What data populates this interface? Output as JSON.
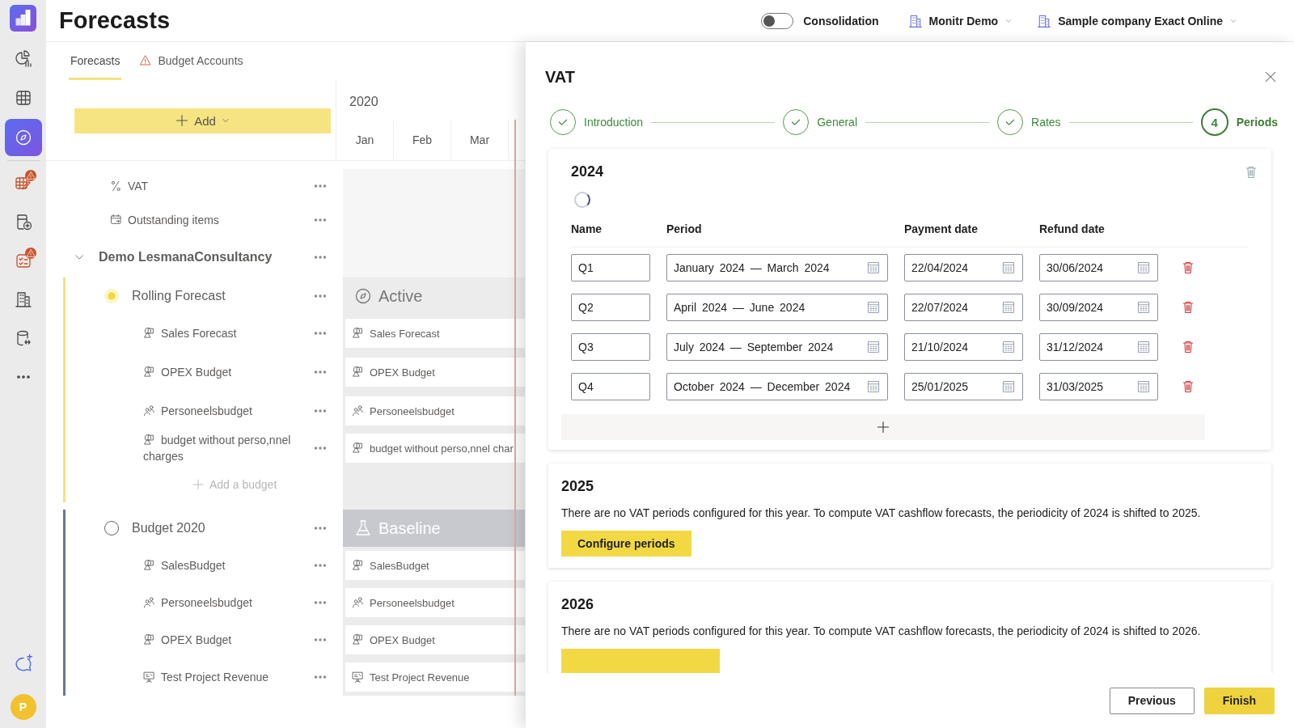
{
  "rail": {
    "items": [
      {
        "kind": "pie-chart",
        "selected": false,
        "warning": false
      },
      {
        "kind": "grid",
        "selected": false,
        "warning": false
      },
      {
        "kind": "compass",
        "selected": true,
        "warning": false
      },
      {
        "kind": "table-pencil",
        "selected": false,
        "warning": true
      },
      {
        "kind": "document-plus",
        "selected": false,
        "warning": false
      },
      {
        "kind": "checklist",
        "selected": false,
        "warning": true
      },
      {
        "kind": "building",
        "selected": false,
        "warning": false
      },
      {
        "kind": "database",
        "selected": false,
        "warning": false
      },
      {
        "kind": "more",
        "selected": false,
        "warning": false
      }
    ],
    "avatar": "P"
  },
  "header": {
    "title": "Forecasts",
    "consolidation": {
      "label": "Consolidation",
      "on": false
    },
    "environment": "Monitr Demo",
    "company": "Sample company Exact Online"
  },
  "tabs": [
    {
      "label": "Forecasts",
      "selected": true,
      "warning": false
    },
    {
      "label": "Budget Accounts",
      "selected": false,
      "warning": true
    }
  ],
  "add_button": "Add",
  "timeline": {
    "year": "2020",
    "months": [
      "Jan",
      "Feb",
      "Mar"
    ]
  },
  "tree": {
    "items": [
      {
        "kind": "percent",
        "label": "VAT"
      },
      {
        "kind": "calendar",
        "label": "Outstanding items"
      }
    ],
    "group": {
      "label": "Demo LesmanaConsultancy",
      "expanded": true,
      "scenarios": [
        {
          "label": "Rolling Forecast",
          "selected": true,
          "lane": "Active",
          "kind": "active",
          "add_label": "Add a budget",
          "budgets": [
            {
              "kind": "shapes",
              "label": "Sales Forecast",
              "lane_label": "Sales Forecast"
            },
            {
              "kind": "shapes",
              "label": "OPEX Budget",
              "lane_label": "OPEX Budget"
            },
            {
              "kind": "people",
              "label": "Personeelsbudget",
              "lane_label": "Personeelsbudget"
            },
            {
              "kind": "shapes",
              "label": "budget without perso,nnel charges",
              "lane_label": "budget without perso,nnel char"
            }
          ]
        },
        {
          "label": "Budget 2020",
          "selected": false,
          "lane": "Baseline",
          "kind": "baseline",
          "budgets": [
            {
              "kind": "shapes",
              "label": "SalesBudget",
              "lane_label": "SalesBudget"
            },
            {
              "kind": "people",
              "label": "Personeelsbudget",
              "lane_label": "Personeelsbudget"
            },
            {
              "kind": "shapes",
              "label": "OPEX Budget",
              "lane_label": "OPEX Budget"
            },
            {
              "kind": "board",
              "label": "Test Project Revenue",
              "lane_label": "Test Project Revenue"
            }
          ]
        }
      ]
    }
  },
  "drawer": {
    "title": "VAT",
    "steps": [
      {
        "label": "Introduction",
        "completed": true,
        "selected": false
      },
      {
        "label": "General",
        "completed": true,
        "selected": false
      },
      {
        "label": "Rates",
        "completed": true,
        "selected": false
      },
      {
        "label": "Periods",
        "completed": false,
        "selected": true,
        "number": "4"
      }
    ],
    "period_card": {
      "year": "2024",
      "loading": true,
      "columns": [
        "Name",
        "Period",
        "Payment date",
        "Refund date"
      ],
      "rows": [
        {
          "name": "Q1",
          "period": "January 2024 — March 2024",
          "payment": "22/04/2024",
          "refund": "30/06/2024"
        },
        {
          "name": "Q2",
          "period": "April 2024 — June 2024",
          "payment": "22/07/2024",
          "refund": "30/09/2024"
        },
        {
          "name": "Q3",
          "period": "July 2024 — September 2024",
          "payment": "21/10/2024",
          "refund": "31/12/2024"
        },
        {
          "name": "Q4",
          "period": "October 2024 — December 2024",
          "payment": "25/01/2025",
          "refund": "31/03/2025"
        }
      ]
    },
    "year_cards": [
      {
        "year": "2025",
        "message": "There are no VAT periods configured for this year. To compute VAT cashflow forecasts, the periodicity of 2024 is shifted to 2025.",
        "button": "Configure periods"
      },
      {
        "year": "2026",
        "message": "There are no VAT periods configured for this year. To compute VAT cashflow forecasts, the periodicity of 2024 is shifted to 2026.",
        "button_partly_hidden": true
      }
    ],
    "footer": [
      {
        "label": "Previous",
        "kind": "secondary"
      },
      {
        "label": "Finish",
        "kind": "primary"
      }
    ]
  }
}
